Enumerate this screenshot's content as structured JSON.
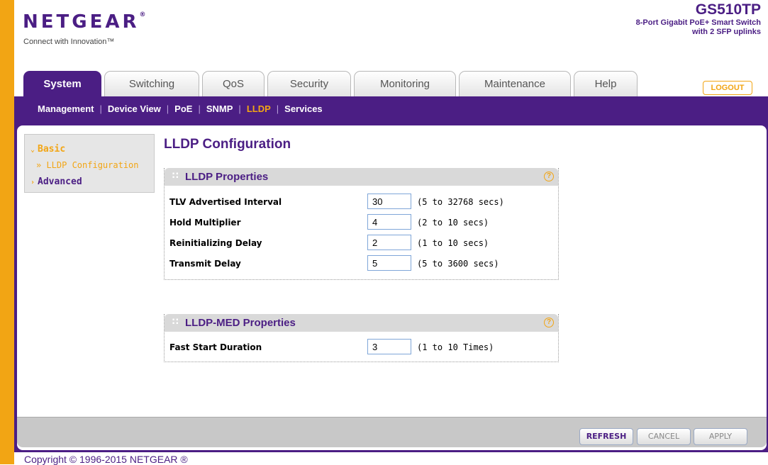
{
  "header": {
    "brand": "NETGEAR",
    "brand_mark": "®",
    "tagline": "Connect with Innovation™",
    "model": "GS510TP",
    "model_desc_line1": "8-Port Gigabit PoE+ Smart Switch",
    "model_desc_line2": "with 2 SFP uplinks",
    "logout_label": "LOGOUT"
  },
  "tabs": [
    {
      "label": "System",
      "active": true
    },
    {
      "label": "Switching"
    },
    {
      "label": "QoS"
    },
    {
      "label": "Security"
    },
    {
      "label": "Monitoring"
    },
    {
      "label": "Maintenance"
    },
    {
      "label": "Help"
    }
  ],
  "subnav": [
    {
      "label": "Management"
    },
    {
      "label": "Device View"
    },
    {
      "label": "PoE"
    },
    {
      "label": "SNMP"
    },
    {
      "label": "LLDP",
      "active": true
    },
    {
      "label": "Services"
    }
  ],
  "side_menu": {
    "basic_label": "Basic",
    "lldp_config_label": "» LLDP Configuration",
    "advanced_label": "Advanced"
  },
  "page_title": "LLDP Configuration",
  "lldp_properties": {
    "title": "LLDP Properties",
    "rows": [
      {
        "label": "TLV Advertised Interval",
        "value": "30",
        "range": "(5 to 32768 secs)"
      },
      {
        "label": "Hold Multiplier",
        "value": "4",
        "range": "(2 to 10 secs)"
      },
      {
        "label": "Reinitializing Delay",
        "value": "2",
        "range": "(1 to 10 secs)"
      },
      {
        "label": "Transmit Delay",
        "value": "5",
        "range": "(5 to 3600 secs)"
      }
    ]
  },
  "lldp_med_properties": {
    "title": "LLDP-MED Properties",
    "rows": [
      {
        "label": "Fast Start Duration",
        "value": "3",
        "range": "(1 to 10 Times)"
      }
    ]
  },
  "buttons": {
    "refresh": "REFRESH",
    "cancel": "CANCEL",
    "apply": "APPLY"
  },
  "footer": "Copyright © 1996-2015 NETGEAR ®",
  "colors": {
    "brand_purple": "#4b1e84",
    "accent_orange": "#f2a514"
  }
}
